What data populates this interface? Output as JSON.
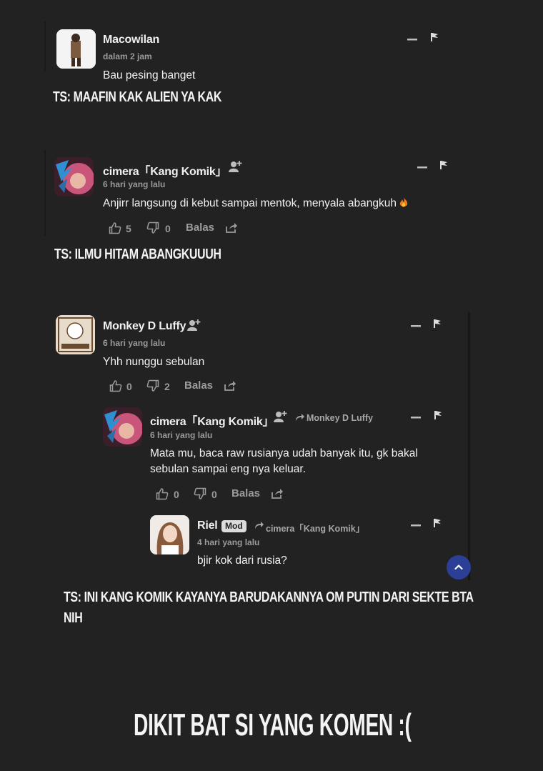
{
  "comments": [
    {
      "author": "Macowilan",
      "time": "dalam 2 jam",
      "text": "Bau pesing banget"
    },
    {
      "author": "cimera「Kang Komik」",
      "time": "6 hari yang lalu",
      "text": "Anjirr langsung di kebut sampai mentok, menyala abangkuh",
      "likes": "5",
      "dislikes": "0",
      "reply_label": "Balas"
    },
    {
      "author": "Monkey D Luffy",
      "time": "6 hari yang lalu",
      "text": "Yhh nunggu sebulan",
      "likes": "0",
      "dislikes": "2",
      "reply_label": "Balas",
      "replies": [
        {
          "author": "cimera「Kang Komik」",
          "reply_to": "Monkey D Luffy",
          "time": "6 hari yang lalu",
          "text_line1": "Mata mu, baca raw rusianya udah banyak itu, gk bakal",
          "text_line2": "sebulan sampai eng nya keluar.",
          "likes": "0",
          "dislikes": "0",
          "reply_label": "Balas",
          "replies": [
            {
              "author": "Riel",
              "badge": "Mod",
              "reply_to": "cimera「Kang Komik」",
              "time": "4 hari yang lalu",
              "text": "bjir kok dari rusia?"
            }
          ]
        }
      ]
    }
  ],
  "captions": {
    "c1": "TS: MAAFIN KAK ALIEN YA KAK",
    "c2": "TS: ILMU HITAM ABANGKUUUH",
    "c3_line1": "TS: INI KANG KOMIK KAYANYA BARUDAKANNYA OM PUTIN DARI SEKTE BTA",
    "c3_line2": "NIH",
    "c4": "DIKIT BAT SI YANG KOMEN :("
  },
  "colors": {
    "background": "#222222",
    "scroll_button": "#2b3f96"
  },
  "icons": [
    "collapse-icon",
    "flag-icon",
    "follow-user-icon",
    "thumbs-up-icon",
    "thumbs-down-icon",
    "share-icon",
    "reply-arrow-icon",
    "fire-emoji",
    "chevron-up-icon"
  ]
}
